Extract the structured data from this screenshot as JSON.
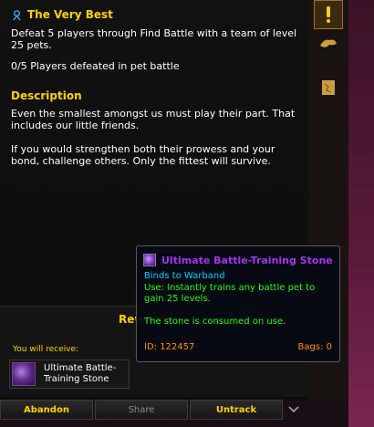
{
  "quest": {
    "title": "The Very Best",
    "objective": "Defeat 5 players through Find Battle with a team of level 25 pets.",
    "progress": "0/5 Players defeated in pet battle",
    "description_heading": "Description",
    "description_p1": "Even the smallest amongst us must play their part. That includes our little friends.",
    "description_p2": "If you would strengthen both their prowess and your bond, challenge others. Only the fittest will survive."
  },
  "rewards": {
    "heading": "Rewards",
    "receive_label": "You will receive:",
    "item_name": "Ultimate Battle-Training Stone"
  },
  "buttons": {
    "abandon": "Abandon",
    "share": "Share",
    "untrack": "Untrack"
  },
  "tooltip": {
    "name": "Ultimate Battle-Training Stone",
    "binds": "Binds to Warband",
    "use": "Use: Instantly trains any battle pet to gain 25 levels.",
    "consumed": "The stone is consumed on use.",
    "id": "ID: 122457",
    "bags": "Bags: 0"
  },
  "icons": {
    "quest": "quest-icon",
    "alert": "exclamation-icon",
    "pet": "pet-icon",
    "map": "map-icon",
    "chevron": "chevron-down-icon"
  },
  "colors": {
    "gold": "#ffd100",
    "epic": "#a335ee",
    "binds": "#00ccff",
    "use": "#1eff00",
    "id": "#ff9000"
  }
}
